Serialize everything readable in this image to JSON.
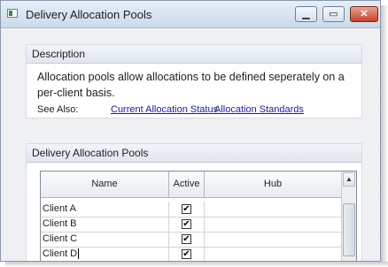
{
  "window": {
    "title": "Delivery Allocation Pools",
    "buttons": {
      "minimize": "▁",
      "maximize": "▭",
      "close": "✕"
    }
  },
  "description": {
    "header": "Description",
    "text": "Allocation pools allow allocations to be defined seperately on a per-client basis.",
    "see_also_label": "See Also:",
    "links": [
      "Current Allocation Status",
      "Allocation Standards"
    ]
  },
  "pools": {
    "header": "Delivery Allocation Pools",
    "columns": [
      "Name",
      "Active",
      "Hub"
    ],
    "rows": [
      {
        "name": "Client A",
        "active": true,
        "hub": ""
      },
      {
        "name": "Client B",
        "active": true,
        "hub": ""
      },
      {
        "name": "Client C",
        "active": true,
        "hub": ""
      },
      {
        "name": "Client D",
        "active": true,
        "hub": ""
      }
    ]
  },
  "icons": {
    "checkmark": "✔",
    "scroll_up": "▲"
  }
}
